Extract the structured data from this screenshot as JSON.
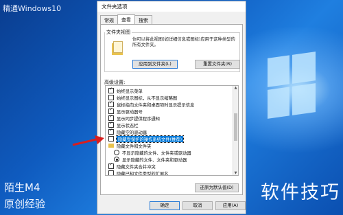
{
  "watermarks": {
    "top_left": "精通Windows10",
    "bottom_left_line1": "陌生M4",
    "bottom_left_line2": "原创经验",
    "bottom_right": "软件技巧"
  },
  "dialog": {
    "title": "文件夹选项",
    "tabs": [
      {
        "label": "常规",
        "active": false
      },
      {
        "label": "查看",
        "active": true
      },
      {
        "label": "搜索",
        "active": false
      }
    ],
    "folder_views": {
      "title": "文件夹视图",
      "description": "你可以将此视图(如详细信息或图标)应用于这种类型的所有文件夹。",
      "apply_button": "应用到文件夹(L)",
      "reset_button": "重置文件夹(R)"
    },
    "advanced_label": "高级设置:",
    "settings": [
      {
        "type": "checkbox",
        "checked": true,
        "label": "始终显示菜单",
        "indent": 1
      },
      {
        "type": "checkbox",
        "checked": false,
        "label": "始终显示图标，从不显示缩略图",
        "indent": 1
      },
      {
        "type": "checkbox",
        "checked": true,
        "label": "鼠标指向文件夹和桌面项时显示提示信息",
        "indent": 1
      },
      {
        "type": "checkbox",
        "checked": true,
        "label": "显示驱动器号",
        "indent": 1
      },
      {
        "type": "checkbox",
        "checked": true,
        "label": "显示同步提供程序通知",
        "indent": 1
      },
      {
        "type": "checkbox",
        "checked": true,
        "label": "显示状态栏",
        "indent": 1
      },
      {
        "type": "checkbox",
        "checked": true,
        "label": "隐藏空的驱动器",
        "indent": 1
      },
      {
        "type": "checkbox",
        "checked": false,
        "label": "隐藏受保护的操作系统文件(推荐)",
        "indent": 1,
        "selected": true
      },
      {
        "type": "folder",
        "label": "隐藏文件和文件夹",
        "indent": 1
      },
      {
        "type": "radio",
        "checked": false,
        "label": "不显示隐藏的文件、文件夹或驱动器",
        "indent": 2
      },
      {
        "type": "radio",
        "checked": true,
        "label": "显示隐藏的文件、文件夹和驱动器",
        "indent": 2
      },
      {
        "type": "checkbox",
        "checked": true,
        "label": "隐藏文件夹合并冲突",
        "indent": 1
      },
      {
        "type": "checkbox",
        "checked": false,
        "label": "隐藏已知文件类型的扩展名",
        "indent": 1
      }
    ],
    "restore_button": "还原为默认值(D)",
    "ok_button": "确定",
    "cancel_button": "取消",
    "apply_button": "应用(A)"
  }
}
